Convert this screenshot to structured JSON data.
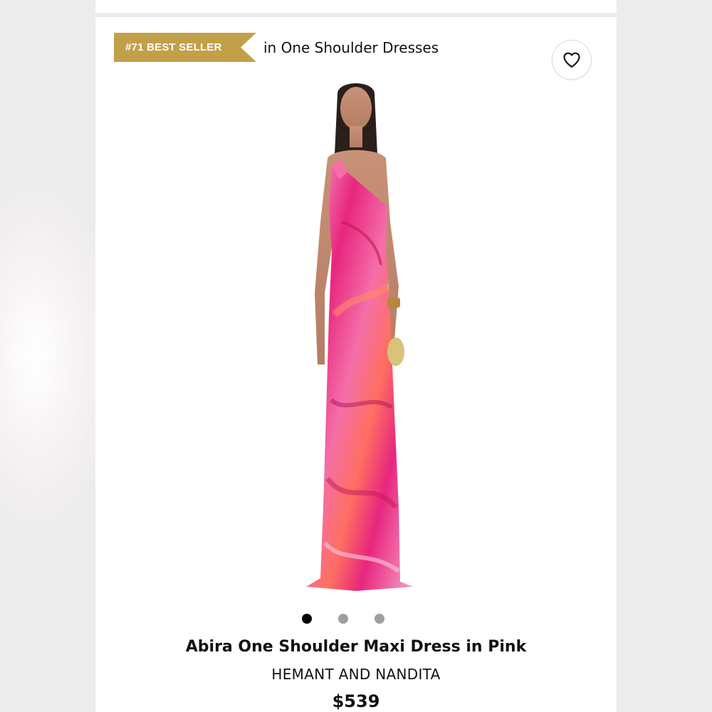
{
  "badge": {
    "rank_label": "#71 BEST SELLER",
    "category_text": "in One Shoulder Dresses",
    "color": "#c2a04a"
  },
  "favorite": {
    "icon": "heart-icon"
  },
  "gallery": {
    "image_count": 3,
    "active_index": 0,
    "dress_colors": [
      "#e8267f",
      "#f46fa8",
      "#f5a3c7",
      "#ff6f61"
    ]
  },
  "product": {
    "title": "Abira One Shoulder Maxi Dress in Pink",
    "brand": "HEMANT AND NANDITA",
    "price": "$539"
  }
}
